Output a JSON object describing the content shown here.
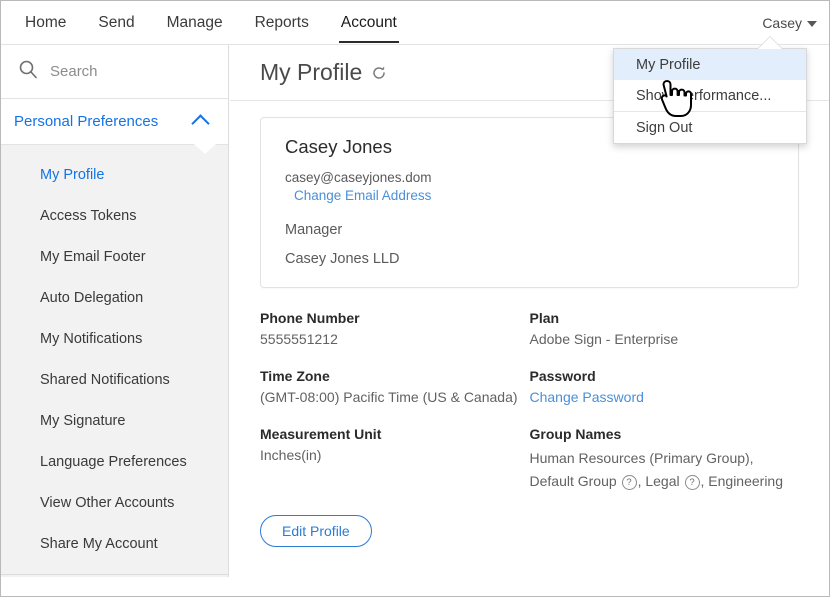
{
  "topnav": {
    "items": [
      {
        "label": "Home",
        "active": false
      },
      {
        "label": "Send",
        "active": false
      },
      {
        "label": "Manage",
        "active": false
      },
      {
        "label": "Reports",
        "active": false
      },
      {
        "label": "Account",
        "active": true
      }
    ],
    "user_label": "Casey",
    "caret_icon": "chevron-down-icon"
  },
  "user_menu": {
    "items": [
      {
        "label": "My Profile",
        "highlighted": true
      },
      {
        "label": "Show Performance...",
        "highlighted": false
      },
      {
        "label": "Sign Out",
        "highlighted": false
      }
    ]
  },
  "sidebar": {
    "search": {
      "placeholder": "Search",
      "value": "",
      "icon": "search-icon"
    },
    "section": {
      "label": "Personal Preferences",
      "expanded": true,
      "icon": "chevron-up-icon"
    },
    "items": [
      {
        "label": "My Profile",
        "active": true
      },
      {
        "label": "Access Tokens",
        "active": false
      },
      {
        "label": "My Email Footer",
        "active": false
      },
      {
        "label": "Auto Delegation",
        "active": false
      },
      {
        "label": "My Notifications",
        "active": false
      },
      {
        "label": "Shared Notifications",
        "active": false
      },
      {
        "label": "My Signature",
        "active": false
      },
      {
        "label": "Language Preferences",
        "active": false
      },
      {
        "label": "View Other Accounts",
        "active": false
      },
      {
        "label": "Share My Account",
        "active": false
      }
    ]
  },
  "main": {
    "title": "My Profile",
    "refresh_icon": "refresh-icon",
    "card": {
      "name": "Casey Jones",
      "email": "casey@caseyjones.dom",
      "change_email_link": "Change Email Address",
      "role": "Manager",
      "organization": "Casey Jones LLD"
    },
    "details_left": [
      {
        "label": "Phone Number",
        "value": "5555551212"
      },
      {
        "label": "Time Zone",
        "value": "(GMT-08:00) Pacific Time (US & Canada)"
      },
      {
        "label": "Measurement Unit",
        "value": "Inches(in)"
      }
    ],
    "details_right": {
      "plan_label": "Plan",
      "plan_value": "Adobe Sign - Enterprise",
      "password_label": "Password",
      "password_link": "Change Password",
      "groups_label": "Group Names",
      "groups_part1": "Human Resources (Primary Group), Default Group",
      "groups_help_1": "?",
      "groups_part2": ", Legal",
      "groups_help_2": "?",
      "groups_part3": ", Engineering"
    },
    "edit_button": "Edit Profile"
  },
  "colors": {
    "accent_blue": "#1473e6",
    "link_blue": "#4b8fd6",
    "button_blue": "#2b7cd3",
    "menu_highlight": "#e2eefb",
    "sidebar_bg": "#f2f2f2"
  }
}
